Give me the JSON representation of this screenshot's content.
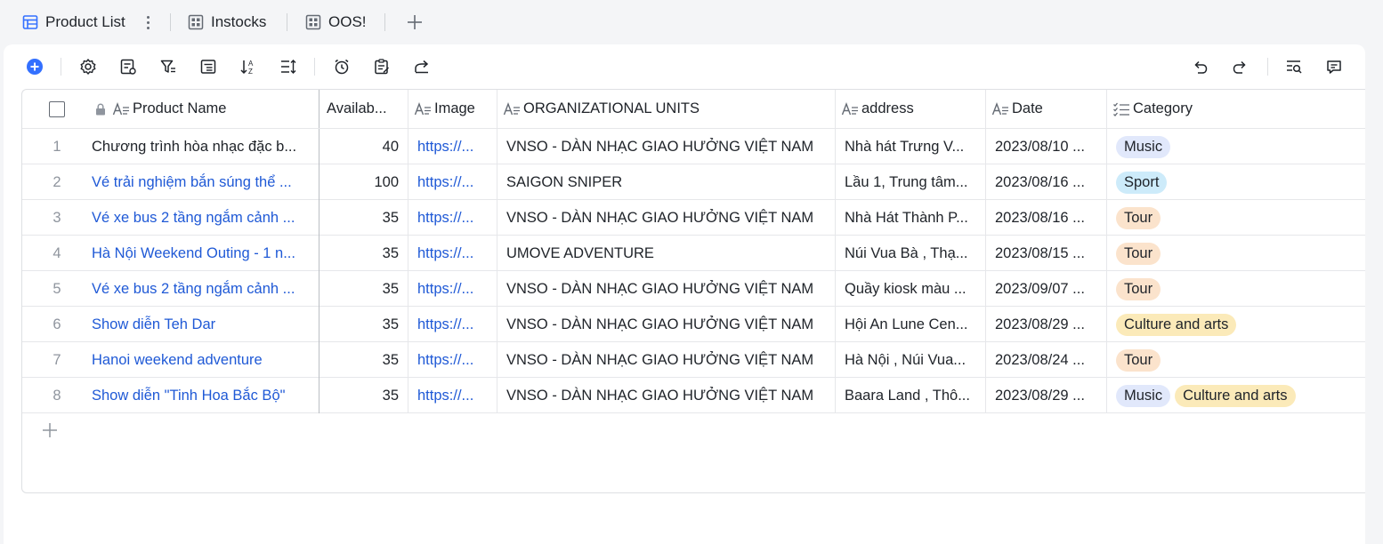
{
  "tabs": [
    {
      "label": "Product List",
      "icon": "table-icon",
      "active": true
    },
    {
      "label": "Instocks",
      "icon": "grid-icon",
      "active": false
    },
    {
      "label": "OOS!",
      "icon": "grid-icon",
      "active": false
    }
  ],
  "toolbar": {
    "left": [
      "add-record-icon",
      "settings-icon",
      "field-config-icon",
      "filter-icon",
      "group-icon",
      "sort-icon",
      "row-height-icon",
      "alarm-icon",
      "form-icon",
      "share-icon"
    ],
    "right": [
      "undo-icon",
      "redo-icon",
      "search-icon",
      "comment-icon"
    ]
  },
  "colors": {
    "accent": "#1f59d6",
    "tag_music": "#e1e8fb",
    "tag_sport": "#cdebfa",
    "tag_tour": "#fbe3cc",
    "tag_culture": "#fbeab9"
  },
  "columns": [
    {
      "label": "Product Name",
      "icon": "text-field-icon",
      "locked": true
    },
    {
      "label": "Availab...",
      "icon": "",
      "locked": false
    },
    {
      "label": "Image",
      "icon": "text-field-icon",
      "locked": false
    },
    {
      "label": "ORGANIZATIONAL UNITS",
      "icon": "text-field-icon",
      "locked": false
    },
    {
      "label": "address",
      "icon": "text-field-icon",
      "locked": false
    },
    {
      "label": "Date",
      "icon": "text-field-icon",
      "locked": false
    },
    {
      "label": "Category",
      "icon": "multi-select-icon",
      "locked": false
    }
  ],
  "rows": [
    {
      "n": "1",
      "name": "Chương trình hòa nhạc đặc b...",
      "name_link": false,
      "avail": "40",
      "image": "https://...",
      "org": "VNSO - DÀN NHẠC GIAO HƯỞNG VIỆT NAM",
      "address": "Nhà hát Trưng V...",
      "date": "2023/08/10 ...",
      "tags": [
        "Music"
      ]
    },
    {
      "n": "2",
      "name": "Vé trải nghiệm bắn súng thể ...",
      "name_link": true,
      "avail": "100",
      "image": "https://...",
      "org": "SAIGON SNIPER",
      "address": "Lầu 1, Trung tâm...",
      "date": "2023/08/16 ...",
      "tags": [
        "Sport"
      ]
    },
    {
      "n": "3",
      "name": "Vé xe bus 2 tầng ngắm cảnh ...",
      "name_link": true,
      "avail": "35",
      "image": "https://...",
      "org": "VNSO - DÀN NHẠC GIAO HƯỞNG VIỆT NAM",
      "address": "Nhà Hát Thành P...",
      "date": "2023/08/16 ...",
      "tags": [
        "Tour"
      ]
    },
    {
      "n": "4",
      "name": "Hà Nội Weekend Outing - 1 n...",
      "name_link": true,
      "avail": "35",
      "image": "https://...",
      "org": "UMOVE ADVENTURE",
      "address": "Núi Vua Bà , Thạ...",
      "date": "2023/08/15 ...",
      "tags": [
        "Tour"
      ]
    },
    {
      "n": "5",
      "name": "Vé xe bus 2 tầng ngắm cảnh ...",
      "name_link": true,
      "avail": "35",
      "image": "https://...",
      "org": "VNSO - DÀN NHẠC GIAO HƯỞNG VIỆT NAM",
      "address": "Quầy kiosk màu ...",
      "date": "2023/09/07 ...",
      "tags": [
        "Tour"
      ]
    },
    {
      "n": "6",
      "name": "Show diễn Teh Dar",
      "name_link": true,
      "avail": "35",
      "image": "https://...",
      "org": "VNSO - DÀN NHẠC GIAO HƯỞNG VIỆT NAM",
      "address": "Hội An Lune Cen...",
      "date": "2023/08/29 ...",
      "tags": [
        "Culture and arts"
      ]
    },
    {
      "n": "7",
      "name": "Hanoi weekend adventure",
      "name_link": true,
      "avail": "35",
      "image": "https://...",
      "org": "VNSO - DÀN NHẠC GIAO HƯỞNG VIỆT NAM",
      "address": "Hà Nội , Núi Vua...",
      "date": "2023/08/24 ...",
      "tags": [
        "Tour"
      ]
    },
    {
      "n": "8",
      "name": "Show diễn \"Tinh Hoa Bắc Bộ\"",
      "name_link": true,
      "avail": "35",
      "image": "https://...",
      "org": "VNSO - DÀN NHẠC GIAO HƯỞNG VIỆT NAM",
      "address": "Baara Land , Thô...",
      "date": "2023/08/29 ...",
      "tags": [
        "Music",
        "Culture and arts"
      ]
    }
  ]
}
